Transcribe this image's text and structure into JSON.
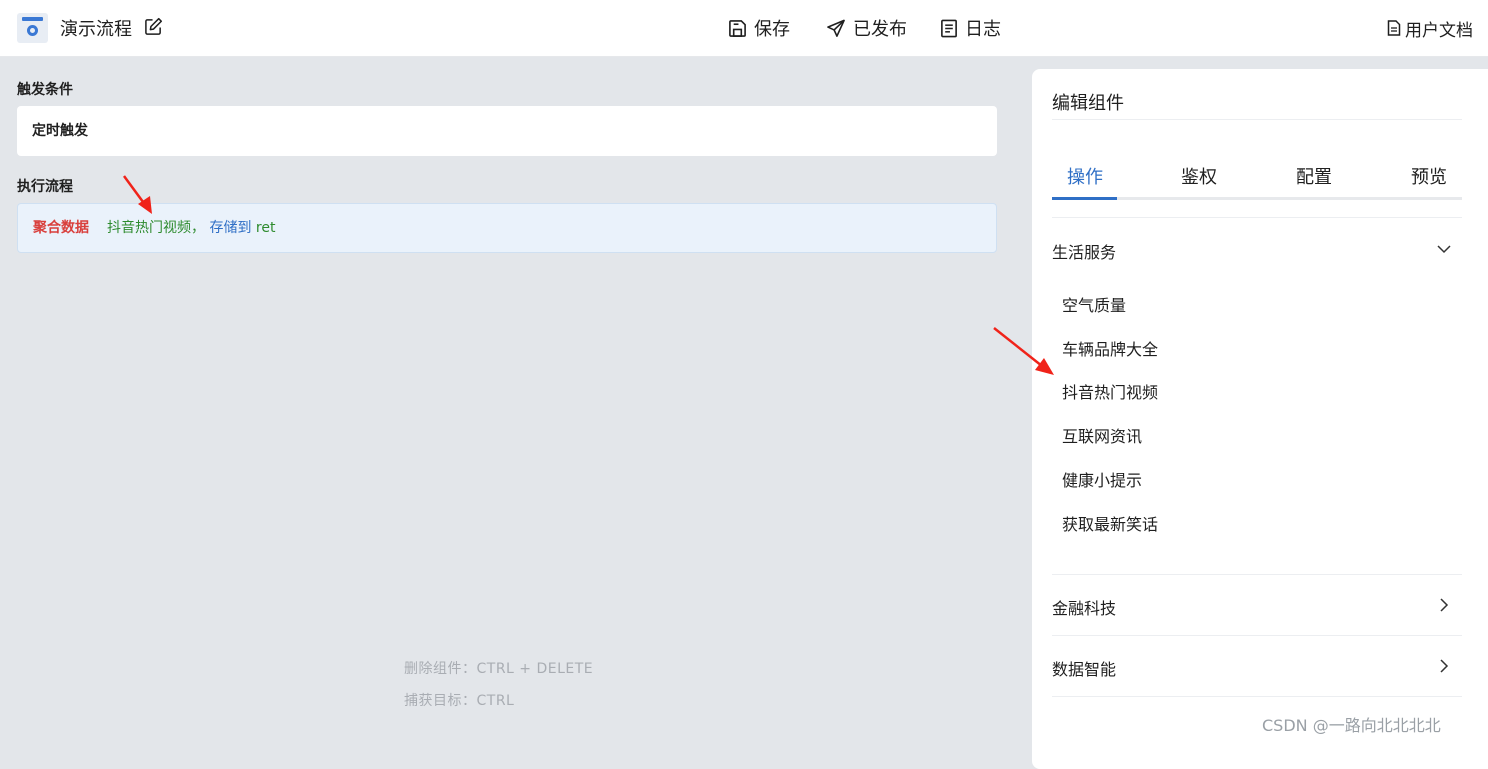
{
  "header": {
    "title": "演示流程",
    "save_label": "保存",
    "publish_label": "已发布",
    "log_label": "日志",
    "docs_label": "用户文档"
  },
  "canvas": {
    "trigger_heading": "触发条件",
    "trigger_value": "定时触发",
    "flow_heading": "执行流程",
    "flow_step": {
      "operation": "聚合数据",
      "source": "抖音热门视频，",
      "store_text": "存储到",
      "variable": "ret"
    },
    "hint_delete": "删除组件：CTRL + DELETE",
    "hint_capture": "捕获目标：CTRL"
  },
  "panel": {
    "title": "编辑组件",
    "tabs": [
      "操作",
      "鉴权",
      "配置",
      "预览"
    ],
    "active_tab": "操作",
    "categories": [
      {
        "label": "生活服务",
        "expanded": true,
        "items": [
          "空气质量",
          "车辆品牌大全",
          "抖音热门视频",
          "互联网资讯",
          "健康小提示",
          "获取最新笑话"
        ]
      },
      {
        "label": "金融科技",
        "expanded": false
      },
      {
        "label": "数据智能",
        "expanded": false
      }
    ]
  },
  "watermark": "CSDN @一路向北北北北",
  "colors": {
    "accent": "#2f6fc6",
    "operation": "#d9403d",
    "source": "#2e8b2e",
    "annotation_arrow": "#f0231a"
  }
}
